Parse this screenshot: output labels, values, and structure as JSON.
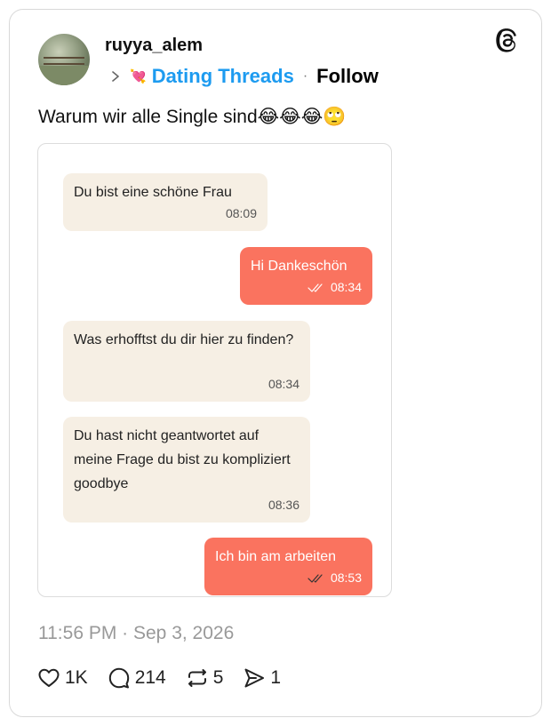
{
  "post": {
    "username": "ruyya_alem",
    "community": "Dating Threads",
    "separator": "·",
    "follow_label": "Follow",
    "heart_icon": "💘",
    "text": "Warum wir alle Single sind😂😂😂🙄",
    "timestamp": "11:56 PM · Sep 3, 2026"
  },
  "chat": {
    "messages": [
      {
        "direction": "incoming",
        "text": "Du bist eine schöne Frau",
        "time": "08:09"
      },
      {
        "direction": "outgoing",
        "text": "Hi Dankeschön",
        "time": "08:34"
      },
      {
        "direction": "incoming",
        "text": "Was erhofftst du dir hier zu finden?",
        "time": "08:34"
      },
      {
        "direction": "incoming",
        "text": "Du hast nicht geantwortet auf meine Frage du bist zu kompliziert goodbye",
        "time": "08:36"
      },
      {
        "direction": "outgoing",
        "text": "Ich bin am arbeiten",
        "time": "08:53"
      }
    ],
    "colors": {
      "incoming": "#f6efe4",
      "outgoing": "#fa735f"
    }
  },
  "actions": {
    "likes": "1K",
    "replies": "214",
    "reposts": "5",
    "shares": "1"
  },
  "colors": {
    "community": "#1d9bf0",
    "muted": "#999999"
  }
}
